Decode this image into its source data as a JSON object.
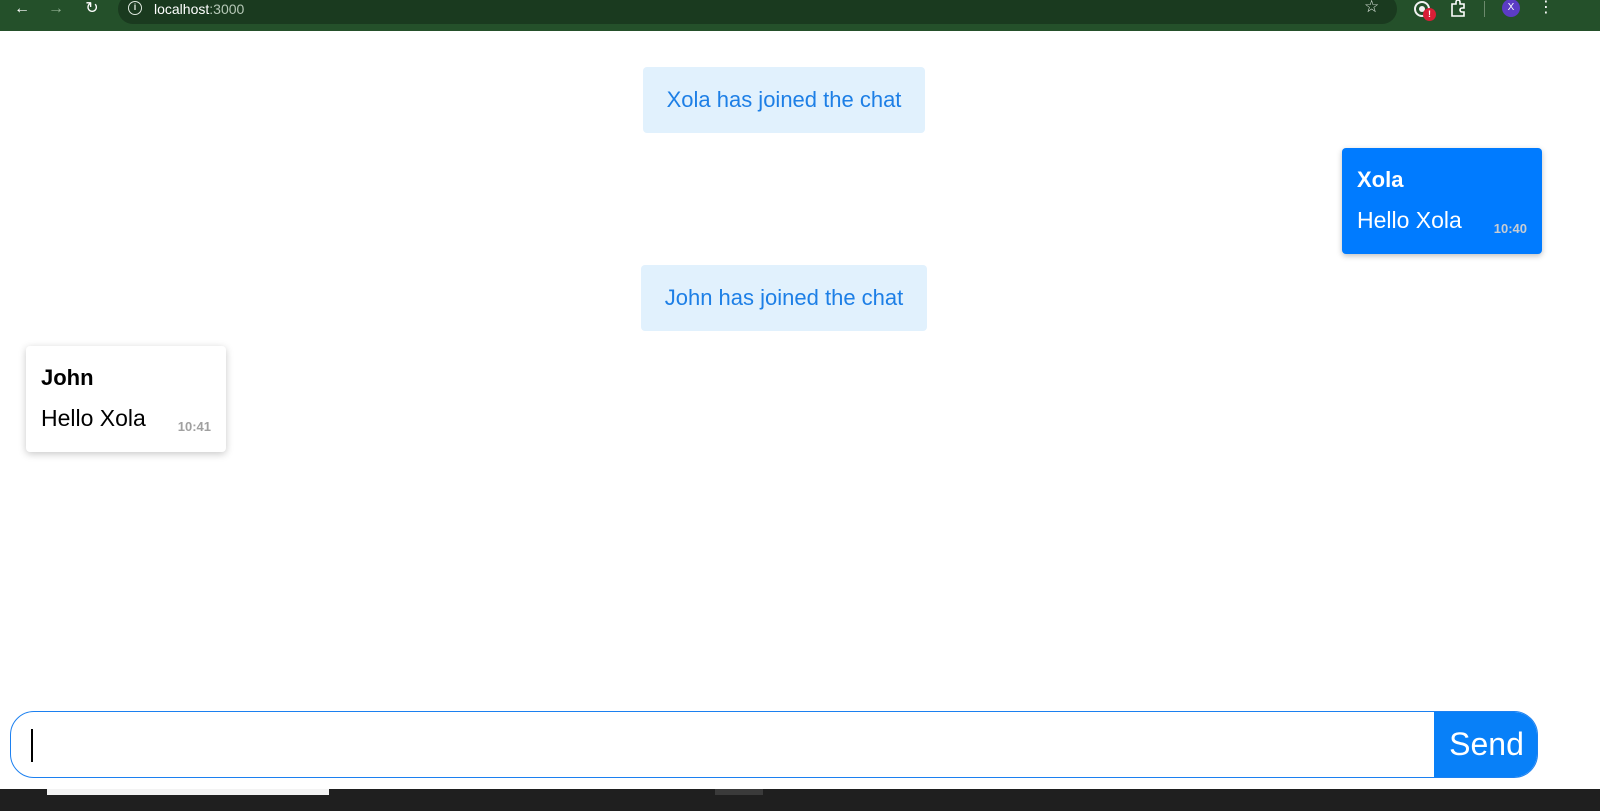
{
  "browser": {
    "url_host": "localhost",
    "url_port": ":3000",
    "profile_initial": "X",
    "extension_badge": "!"
  },
  "chat": {
    "system_messages": [
      {
        "text": "Xola has joined the chat"
      },
      {
        "text": "John has joined the chat"
      }
    ],
    "messages": [
      {
        "sender": "Xola",
        "text": "Hello Xola",
        "time": "10:40",
        "own": true
      },
      {
        "sender": "John",
        "text": "Hello Xola",
        "time": "10:41",
        "own": false
      }
    ]
  },
  "composer": {
    "value": "",
    "placeholder": "",
    "send_label": "Send"
  },
  "colors": {
    "toolbar": "#24502a",
    "system_bg": "#e1f1fd",
    "system_text": "#1d7fe6",
    "own_bubble": "#007bff",
    "send_button": "#0880f8",
    "composer_border": "#1c80f0"
  },
  "icons": [
    "back-arrow-icon",
    "forward-arrow-icon",
    "reload-icon",
    "site-info-icon",
    "bookmark-star-icon",
    "extension-icon",
    "extensions-puzzle-icon",
    "profile-avatar",
    "browser-menu-icon"
  ]
}
